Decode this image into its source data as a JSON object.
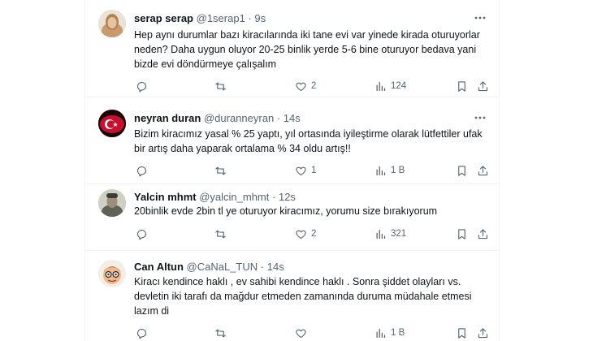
{
  "tweets": [
    {
      "name": "serap serap",
      "handle": "@1serap1",
      "sep": "·",
      "time": "9s",
      "text": "Hep aynı durumlar bazı kiracılarında iki tane evi var yinede kirada oturuyorlar neden? Daha uygun oluyor 20-25 binlik yerde 5-6 bine oturuyor bedava yani bizde evi döndürmeye çalışalım",
      "replies": "",
      "retweets": "",
      "likes": "2",
      "views": "124",
      "avatar": "woman-portrait"
    },
    {
      "name": "neyran duran",
      "handle": "@duranneyran",
      "sep": "·",
      "time": "14s",
      "text": "Bizim kiracımız yasal % 25 yaptı, yıl ortasında iyileştirme olarak lütfettiler ufak bir artış daha yaparak ortalama % 34 oldu artış!!",
      "replies": "",
      "retweets": "",
      "likes": "1",
      "views": "1 B",
      "avatar": "turkish-flag"
    },
    {
      "name": "Yalcin mhmt",
      "handle": "@yalcin_mhmt",
      "sep": "·",
      "time": "12s",
      "text": "20binlik evde 2bin tl ye oturuyor kiracımız, yorumu size bırakıyorum",
      "replies": "",
      "retweets": "",
      "likes": "2",
      "views": "321",
      "avatar": "man-portrait"
    },
    {
      "name": "Can Altun",
      "handle": "@CaNaL_TUN",
      "sep": "·",
      "time": "14s",
      "text": "Kiracı kendince haklı , ev sahibi kendince haklı . Sonra şiddet olayları vs. devletin iki tarafı da mağdur etmeden zamanında duruma müdahale etmesi lazım di",
      "replies": "",
      "retweets": "",
      "likes": "",
      "views": "1 B",
      "avatar": "cartoon-face"
    }
  ],
  "colors": {
    "text": "#0f1419",
    "muted": "#536471",
    "border": "#eff3f4"
  }
}
